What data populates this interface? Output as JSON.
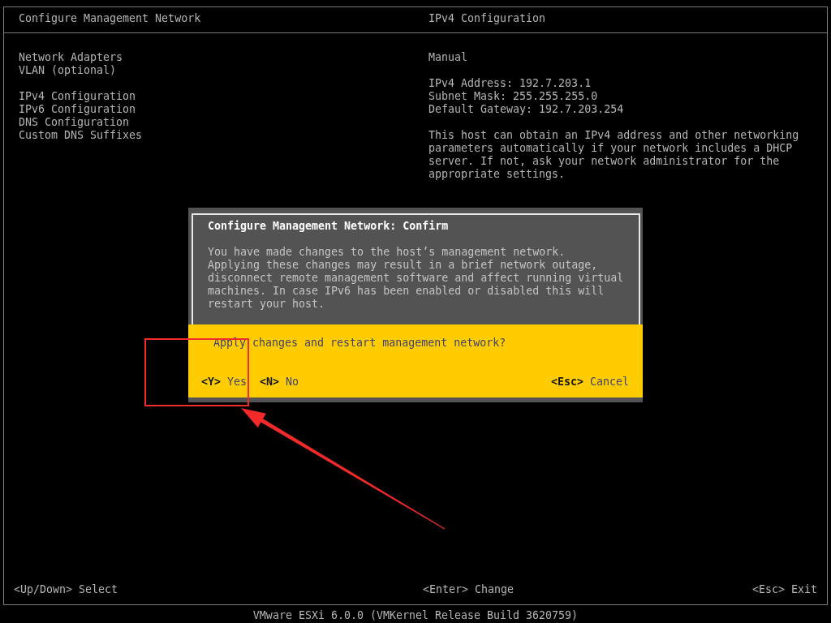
{
  "window": {
    "title": "Configure Management Network"
  },
  "menu": {
    "groups": [
      [
        "Network Adapters",
        "VLAN (optional)"
      ],
      [
        "IPv4 Configuration",
        "IPv6 Configuration",
        "DNS Configuration",
        "Custom DNS Suffixes"
      ]
    ]
  },
  "detail": {
    "title": "IPv4 Configuration",
    "mode": "Manual",
    "fields": [
      {
        "label": "IPv4 Address:",
        "value": "192.7.203.1"
      },
      {
        "label": "Subnet Mask:",
        "value": "255.255.255.0"
      },
      {
        "label": "Default Gateway:",
        "value": "192.7.203.254"
      }
    ],
    "description": "This host can obtain an IPv4 address and other networking parameters automatically if your network includes a DHCP server. If not, ask your network administrator for the appropriate settings."
  },
  "footer_hints": [
    "<Up/Down> Select",
    "<Enter> Change",
    "<Esc> Exit"
  ],
  "version": "VMware ESXi 6.0.0 (VMKernel Release Build 3620759)",
  "dialog": {
    "title": "Configure Management Network: Confirm",
    "message": "You have made changes to the host’s management network.\nApplying these changes may result in a brief network outage, disconnect remote management software and affect running virtual machines. In case IPv6 has been enabled or disabled this will restart your host.",
    "question": "Apply changes and restart management network?",
    "buttons": [
      {
        "key": "<Y>",
        "label": "Yes"
      },
      {
        "key": "<N>",
        "label": "No"
      },
      {
        "key": "<Esc>",
        "label": "Cancel"
      }
    ]
  }
}
